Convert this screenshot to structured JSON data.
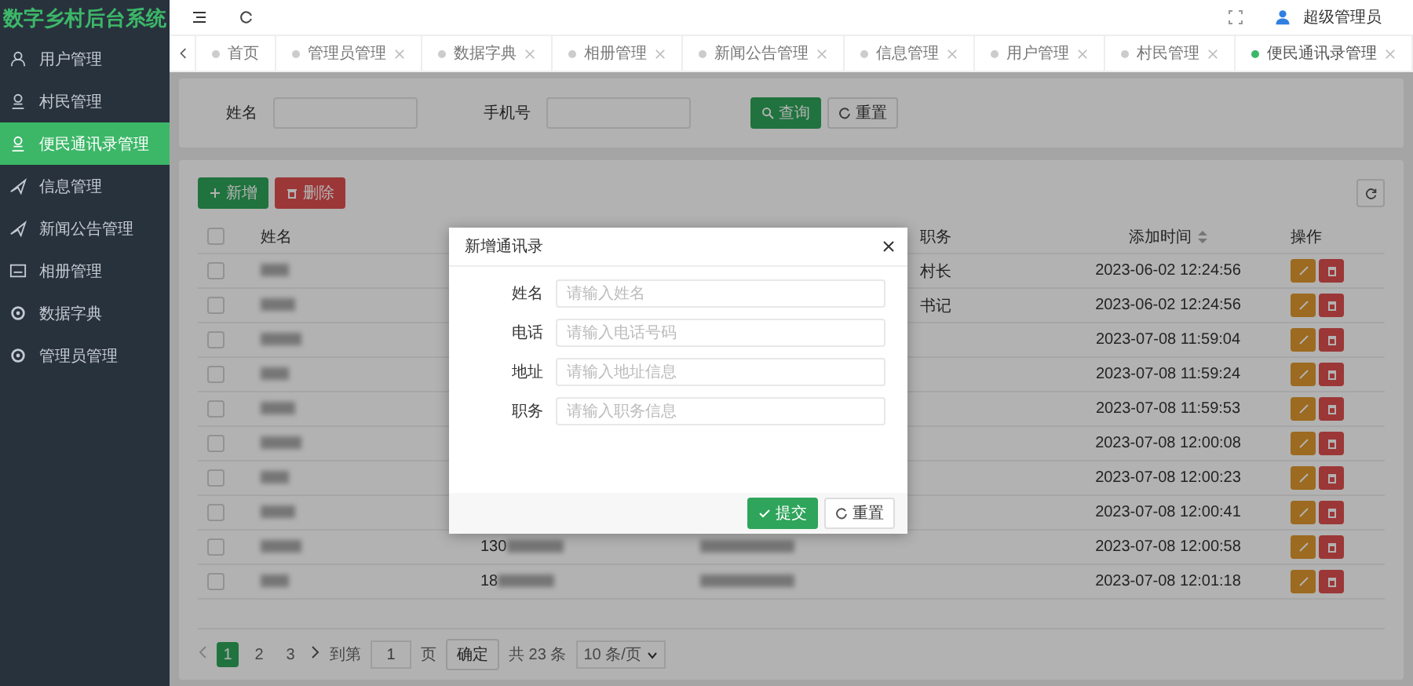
{
  "sidebar": {
    "title": "数字乡村后台系统",
    "items": [
      {
        "label": "用户管理",
        "selected": false
      },
      {
        "label": "村民管理",
        "selected": false
      },
      {
        "label": "便民通讯录管理",
        "selected": true
      },
      {
        "label": "信息管理",
        "selected": false
      },
      {
        "label": "新闻公告管理",
        "selected": false
      },
      {
        "label": "相册管理",
        "selected": false
      },
      {
        "label": "数据字典",
        "selected": false
      },
      {
        "label": "管理员管理",
        "selected": false
      }
    ]
  },
  "topbar": {
    "user": "超级管理员"
  },
  "tabs": [
    {
      "label": "首页",
      "selected": false,
      "closable": false
    },
    {
      "label": "管理员管理",
      "selected": false,
      "closable": true
    },
    {
      "label": "数据字典",
      "selected": false,
      "closable": true
    },
    {
      "label": "相册管理",
      "selected": false,
      "closable": true
    },
    {
      "label": "新闻公告管理",
      "selected": false,
      "closable": true
    },
    {
      "label": "信息管理",
      "selected": false,
      "closable": true
    },
    {
      "label": "用户管理",
      "selected": false,
      "closable": true
    },
    {
      "label": "村民管理",
      "selected": false,
      "closable": true
    },
    {
      "label": "便民通讯录管理",
      "selected": true,
      "closable": true
    }
  ],
  "search": {
    "fields": [
      {
        "label": "姓名"
      },
      {
        "label": "手机号"
      }
    ],
    "buttons": [
      {
        "label": "查询",
        "kind": "primary"
      },
      {
        "label": "重置",
        "kind": "default"
      }
    ]
  },
  "toolbar": {
    "buttons": [
      {
        "label": "新增",
        "kind": "add"
      },
      {
        "label": "删除",
        "kind": "delete"
      }
    ]
  },
  "table": {
    "header_checked": false,
    "headers": {
      "name": "姓名",
      "position": "职务",
      "time": "添加时间",
      "actions": "操作"
    },
    "rows": [
      {
        "checked": false,
        "position": "村长",
        "time": "2023-06-02 12:24:56"
      },
      {
        "checked": false,
        "position": "书记",
        "time": "2023-06-02 12:24:56"
      },
      {
        "checked": false,
        "time": "2023-07-08 11:59:04"
      },
      {
        "checked": false,
        "time": "2023-07-08 11:59:24"
      },
      {
        "checked": false,
        "time": "2023-07-08 11:59:53"
      },
      {
        "checked": false,
        "time": "2023-07-08 12:00:08"
      },
      {
        "checked": false,
        "time": "2023-07-08 12:00:23"
      },
      {
        "checked": false,
        "time": "2023-07-08 12:00:41"
      },
      {
        "checked": false,
        "phone": "130",
        "time": "2023-07-08 12:00:58"
      },
      {
        "checked": false,
        "phone": "18",
        "time": "2023-07-08 12:01:18"
      }
    ]
  },
  "pagination": {
    "pages": [
      {
        "label": "1",
        "selected": true
      },
      {
        "label": "2",
        "selected": false
      },
      {
        "label": "3",
        "selected": false
      }
    ],
    "goto_label": "到第",
    "goto_value": "1",
    "page_unit": "页",
    "confirm": "确定",
    "total": "共 23 条",
    "page_size": "10 条/页"
  },
  "modal": {
    "title": "新增通讯录",
    "fields": [
      {
        "label": "姓名",
        "placeholder": "请输入姓名"
      },
      {
        "label": "电话",
        "placeholder": "请输入电话号码"
      },
      {
        "label": "地址",
        "placeholder": "请输入地址信息"
      },
      {
        "label": "职务",
        "placeholder": "请输入职务信息"
      }
    ],
    "buttons": [
      {
        "label": "提交",
        "kind": "primary"
      },
      {
        "label": "重置",
        "kind": "default"
      }
    ]
  }
}
